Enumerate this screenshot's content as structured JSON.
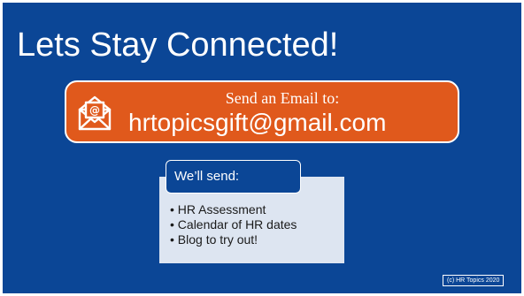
{
  "slide": {
    "title": "Lets Stay Connected!",
    "background_color": "#0b4696",
    "email_callout": {
      "label": "Send an Email to:",
      "address": "hrtopicsgift@gmail.com",
      "icon": "envelope-at-icon",
      "color": "#e0591c"
    },
    "list_heading": "We’ll send:",
    "list_items": [
      "HR Assessment",
      "Calendar of HR dates",
      "Blog to try out!"
    ],
    "copyright": "(c) HR Topics 2020"
  }
}
